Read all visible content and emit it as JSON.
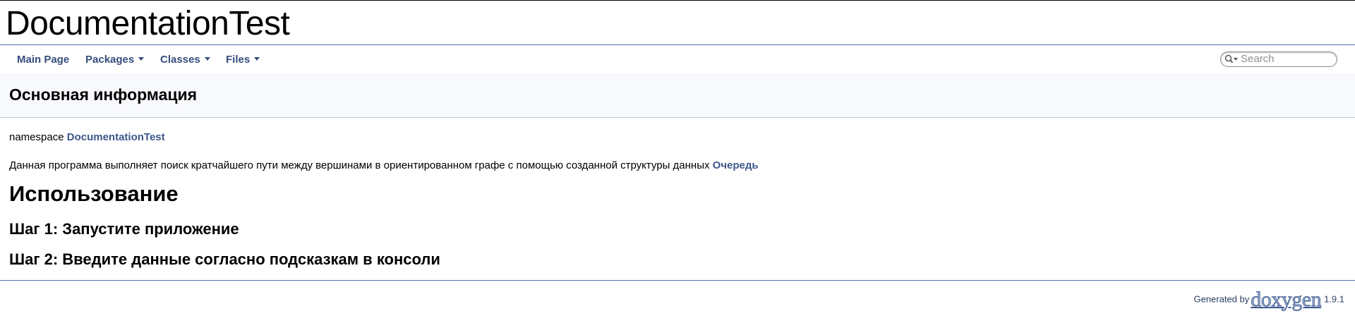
{
  "project": {
    "name": "DocumentationTest"
  },
  "nav": {
    "items": [
      {
        "label": "Main Page"
      },
      {
        "label": "Packages"
      },
      {
        "label": "Classes"
      },
      {
        "label": "Files"
      }
    ],
    "search": {
      "placeholder": "Search"
    }
  },
  "header": {
    "title": "Основная информация"
  },
  "content": {
    "namespace_prefix": "namespace",
    "namespace_link": "DocumentationTest",
    "description": "Данная программа выполняет поиск кратчайшего пути между вершинами в ориентированном графе с помощью созданной структуры данных",
    "description_link": "Очередь",
    "usage_heading": "Использование",
    "step1": "Шаг 1: Запустите приложение",
    "step2": "Шаг 2: Введите данные согласно подсказкам в консоли"
  },
  "footer": {
    "generated_by": "Generated by",
    "logo_text": "doxygen",
    "version": "1.9.1"
  },
  "colors": {
    "nav_link": "#364d7c",
    "link": "#3d578c",
    "header_bg": "#f8f9fc",
    "border": "#5373b4"
  }
}
